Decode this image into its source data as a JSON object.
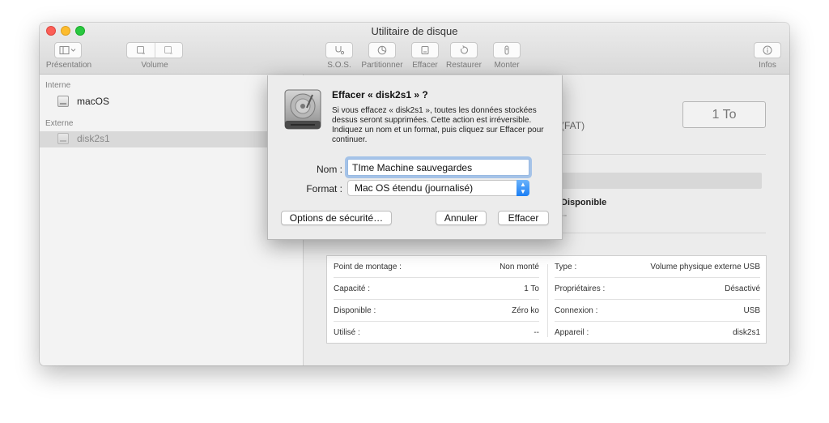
{
  "window": {
    "title": "Utilitaire de disque"
  },
  "toolbar": {
    "presentation": "Présentation",
    "volume": "Volume",
    "sos": "S.O.S.",
    "partition": "Partitionner",
    "erase": "Effacer",
    "restore": "Restaurer",
    "mount": "Monter",
    "info": "Infos"
  },
  "sidebar": {
    "internal_header": "Interne",
    "external_header": "Externe",
    "items": [
      {
        "label": "macOS",
        "selected": false
      },
      {
        "label": "disk2s1",
        "selected": true
      }
    ]
  },
  "main": {
    "size": "1 To",
    "format_partial": "(FAT)",
    "available_label": "Disponible",
    "available_value": "--"
  },
  "info": {
    "left": [
      {
        "key": "Point de montage :",
        "value": "Non monté"
      },
      {
        "key": "Capacité :",
        "value": "1 To"
      },
      {
        "key": "Disponible :",
        "value": "Zéro ko"
      },
      {
        "key": "Utilisé :",
        "value": "--"
      }
    ],
    "right": [
      {
        "key": "Type :",
        "value": "Volume physique externe USB"
      },
      {
        "key": "Propriétaires :",
        "value": "Désactivé"
      },
      {
        "key": "Connexion :",
        "value": "USB"
      },
      {
        "key": "Appareil :",
        "value": "disk2s1"
      }
    ]
  },
  "dialog": {
    "title": "Effacer « disk2s1 » ?",
    "message": "Si vous effacez « disk2s1 », toutes les données stockées dessus seront supprimées. Cette action est irréversible. Indiquez un nom et un format, puis cliquez sur Effacer pour continuer.",
    "name_label": "Nom :",
    "name_value": "TIme Machine sauvegardes",
    "format_label": "Format :",
    "format_value": "Mac OS étendu (journalisé)",
    "security_button": "Options de sécurité…",
    "cancel_button": "Annuler",
    "erase_button": "Effacer"
  },
  "colors": {
    "close": "#fc5f57",
    "minimize": "#fdbc2e",
    "maximize": "#29c840",
    "focus_ring": "#6ca2e6",
    "select_accent": "#1a7ef5"
  }
}
